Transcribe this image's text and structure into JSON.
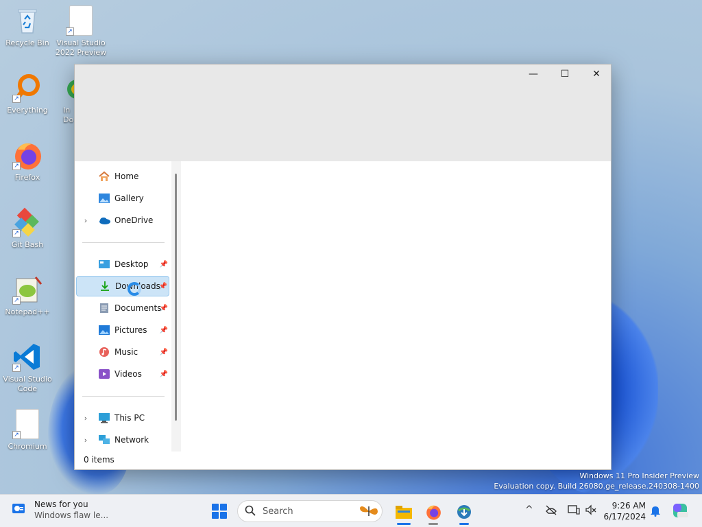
{
  "desktop": {
    "icons": [
      {
        "label": "Recycle Bin"
      },
      {
        "label": "Visual Studio 2022 Preview"
      },
      {
        "label": "Everything"
      },
      {
        "label": "In Do"
      },
      {
        "label": "Firefox"
      },
      {
        "label": "Git Bash"
      },
      {
        "label": "Notepad++"
      },
      {
        "label": "Visual Studio Code"
      },
      {
        "label": "Chromium"
      }
    ]
  },
  "window": {
    "controls": {
      "minimize": "—",
      "maximize": "☐",
      "close": "✕"
    },
    "nav": {
      "group1": [
        {
          "label": "Home",
          "icon": "home-icon"
        },
        {
          "label": "Gallery",
          "icon": "gallery-icon"
        },
        {
          "label": "OneDrive",
          "icon": "onedrive-icon",
          "expand": "›"
        }
      ],
      "quick_access": [
        {
          "label": "Desktop",
          "icon": "desktop-folder-icon",
          "pin": "📌"
        },
        {
          "label": "Downloads",
          "icon": "downloads-icon",
          "pin": "📌"
        },
        {
          "label": "Documents",
          "icon": "documents-icon",
          "pin": "📌"
        },
        {
          "label": "Pictures",
          "icon": "pictures-icon",
          "pin": "📌"
        },
        {
          "label": "Music",
          "icon": "music-icon",
          "pin": "📌"
        },
        {
          "label": "Videos",
          "icon": "videos-icon",
          "pin": "📌"
        }
      ],
      "group3": [
        {
          "label": "This PC",
          "icon": "this-pc-icon",
          "expand": "›"
        },
        {
          "label": "Network",
          "icon": "network-icon",
          "expand": "›"
        }
      ]
    },
    "status": "0 items"
  },
  "watermark": {
    "line1": "Windows 11 Pro Insider Preview",
    "line2": "Evaluation copy. Build 26080.ge_release.240308-1400"
  },
  "taskbar": {
    "news_title": "News for you",
    "news_sub": "Windows flaw le...",
    "search_label": "Search",
    "tray_chevron": "^",
    "time": "9:26 AM",
    "date": "6/17/2024",
    "accent": "#1a73e8"
  }
}
